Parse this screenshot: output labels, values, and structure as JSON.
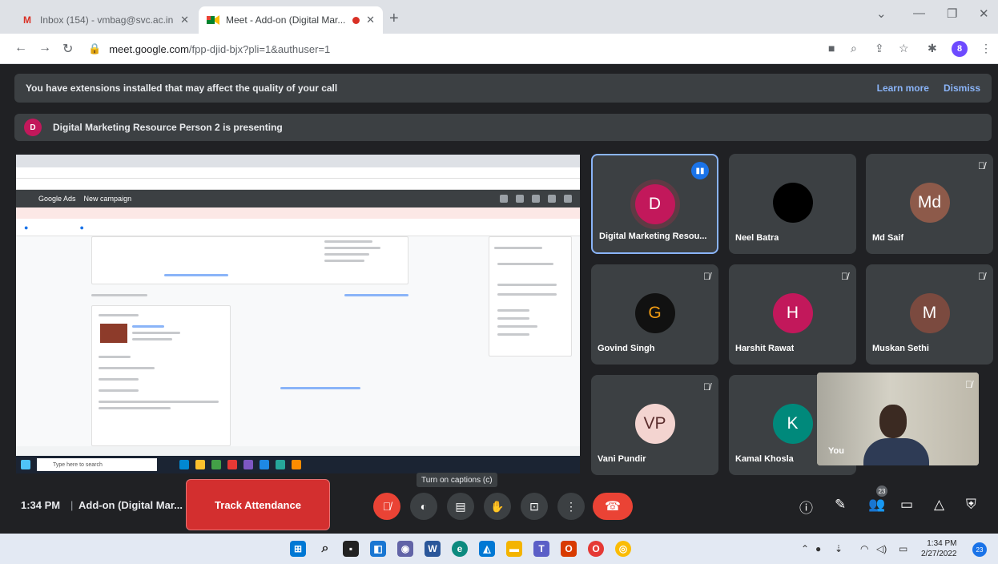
{
  "browser": {
    "tabs": [
      {
        "title": "Inbox (154) - vmbag@svc.ac.in",
        "favicon": "gmail-icon"
      },
      {
        "title": "Meet - Add-on (Digital Mar...",
        "favicon": "meet-icon",
        "recording": true
      }
    ],
    "url": {
      "host": "meet.google.com",
      "path": "/fpp-djid-bjx?pli=1&authuser=1"
    },
    "profile_initial": "8"
  },
  "meet": {
    "extension_banner": {
      "text": "You have extensions installed that may affect the quality of your call",
      "learn_more": "Learn more",
      "dismiss": "Dismiss"
    },
    "presenting_banner": {
      "initial": "D",
      "text": "Digital Marketing Resource Person 2 is presenting"
    },
    "shared_screen": {
      "app_title": "Google Ads",
      "page_title": "New campaign",
      "taskbar_search": "Type here to search"
    },
    "participants": [
      {
        "initial": "D",
        "name": "Digital Marketing Resou...",
        "color": "#c2185b",
        "speaking": true,
        "muted": false
      },
      {
        "initial": "",
        "name": "Neel Batra",
        "color": "#000000",
        "speaking": false,
        "muted": false
      },
      {
        "initial": "Md",
        "name": "Md Saif",
        "color": "#8d5a4a",
        "speaking": false,
        "muted": true
      },
      {
        "initial": "G",
        "name": "Govind Singh",
        "color": "#111111",
        "speaking": false,
        "muted": true
      },
      {
        "initial": "H",
        "name": "Harshit Rawat",
        "color": "#c2185b",
        "speaking": false,
        "muted": true
      },
      {
        "initial": "M",
        "name": "Muskan Sethi",
        "color": "#7b4a3f",
        "speaking": false,
        "muted": true
      },
      {
        "initial": "VP",
        "name": "Vani Pundir",
        "color": "#f3d4d0",
        "speaking": false,
        "muted": true
      },
      {
        "initial": "K",
        "name": "Kamal Khosla",
        "color": "#00897b",
        "speaking": false,
        "muted": false
      }
    ],
    "self_view": {
      "label": "You"
    },
    "bottom_bar": {
      "time": "1:34 PM",
      "meeting_name": "Add-on (Digital Mar...",
      "track_attendance": "Track Attendance",
      "captions_tooltip": "Turn on captions (c)",
      "people_count": "23"
    }
  },
  "windows": {
    "time": "1:34 PM",
    "date": "2/27/2022",
    "notifications": "23"
  }
}
